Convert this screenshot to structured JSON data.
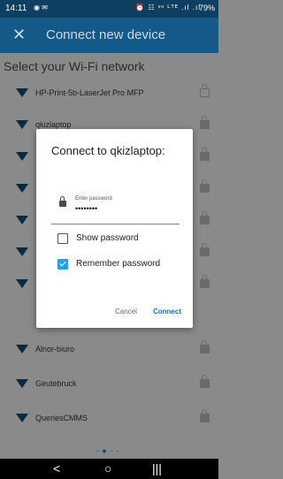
{
  "status_bar": {
    "time": "14:11",
    "right_icons": "⏰ ☷ ᵛᵒ ᴸᵀᴱ .ıl .ıl",
    "battery": "79%"
  },
  "app_bar": {
    "close": "✕",
    "title": "Connect new device"
  },
  "subtitle": "Select your Wi-Fi network",
  "networks": [
    {
      "name": "HP-Print-5b-LaserJet Pro MFP",
      "lock": "open"
    },
    {
      "name": "qkizlaptop",
      "lock": "closed"
    },
    {
      "name": "",
      "lock": "closed"
    },
    {
      "name": "",
      "lock": "closed"
    },
    {
      "name": "",
      "lock": "closed"
    },
    {
      "name": "",
      "lock": "closed"
    },
    {
      "name": "",
      "lock": "closed"
    },
    {
      "name": "Alnor-biuro",
      "lock": "closed"
    },
    {
      "name": "Geutebruck",
      "lock": "closed"
    },
    {
      "name": "QueriesCMMS",
      "lock": "closed"
    }
  ],
  "pager": {
    "dots": "•",
    "active": "●"
  },
  "nav_bar": {
    "back": "<",
    "home": "○",
    "recents": "|||"
  },
  "dialog": {
    "title": "Connect to qkizlaptop:",
    "password_label": "Enter password",
    "password_value": "••••••••",
    "show_password": {
      "label": "Show password",
      "checked": false
    },
    "remember_password": {
      "label": "Remember password",
      "checked": true
    },
    "cancel": "Cancel",
    "connect": "Connect"
  },
  "colors": {
    "app_bar": "#145a88",
    "status_bar": "#0e3e60",
    "accent": "#1a6ad6",
    "checkbox": "#1da1f2"
  }
}
